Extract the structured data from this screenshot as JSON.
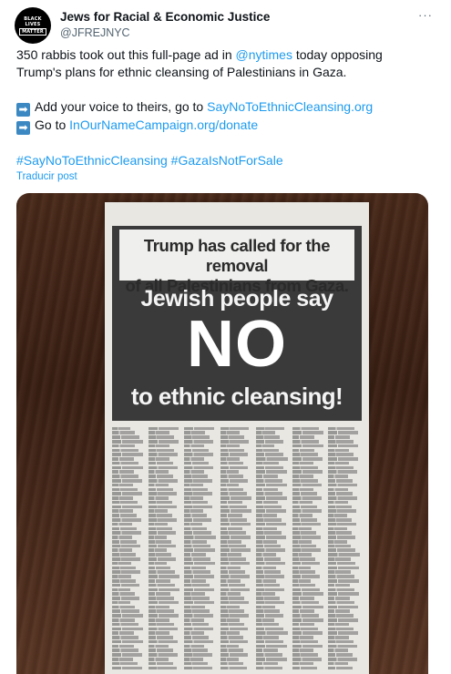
{
  "tweet": {
    "author": {
      "display_name": "Jews for Racial & Economic Justice",
      "handle": "@JFREJNYC",
      "avatar_lines": [
        "BLACK",
        "LIVES",
        "MATTER"
      ]
    },
    "more_label": "···",
    "lines": {
      "l1_pre": "350 rabbis took out this full-page ad in ",
      "l1_mention": "@nytimes",
      "l1_post": " today opposing",
      "l2": "Trump's plans for ethnic cleansing of Palestinians in Gaza.",
      "l3_emoji": "➡",
      "l3_pre": "Add your voice to theirs, go to ",
      "l3_link": "SayNoToEthnicCleansing.org",
      "l4_emoji": "➡",
      "l4_pre": "Go to ",
      "l4_link": "InOurNameCampaign.org/donate",
      "hashtag1": "#SayNoToEthnicCleansing",
      "hashtag2": "#GazaIsNotForSale"
    },
    "translate_label": "Traducir post"
  },
  "ad": {
    "headline_1": "Trump has called for the removal",
    "headline_2": "of all Palestinians from Gaza.",
    "line_1": "Jewish people say",
    "line_2": "NO",
    "line_3": "to ethnic cleansing!"
  },
  "colors": {
    "link": "#1d9bf0",
    "text": "#0f1419",
    "secondary": "#536471",
    "ad_background": "#3a3a3a",
    "paper": "#e9e7e2"
  }
}
